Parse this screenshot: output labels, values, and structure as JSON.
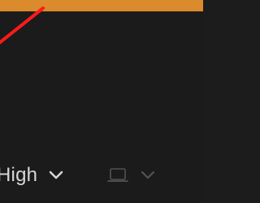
{
  "top_bar": {
    "color": "#db8a2c"
  },
  "annotation": {
    "color": "#ff1a1a",
    "shape": "diagonal-line"
  },
  "toolbar": {
    "quality_label": "High",
    "quality_icon": "chevron-down-icon",
    "device_icon": "laptop-icon",
    "device_chevron_icon": "chevron-down-icon"
  },
  "colors": {
    "background": "#1b1b1b",
    "text": "#d8d8d8",
    "muted_icon": "#595959"
  }
}
